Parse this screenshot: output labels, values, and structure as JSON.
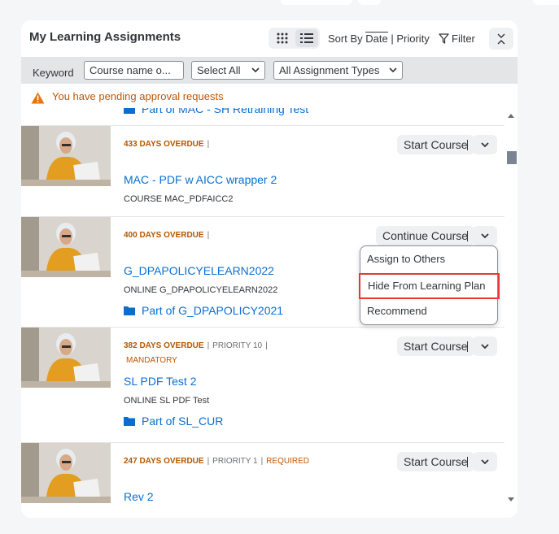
{
  "header": {
    "title": "My Learning Assignments",
    "sort_by_label": "Sort By",
    "sort_date": "Date",
    "sort_separator": "|",
    "sort_priority": "Priority",
    "filter_label": "Filter"
  },
  "filterbar": {
    "keyword_label": "Keyword",
    "keyword_placeholder": "Course name o...",
    "select_all": "Select All",
    "assignment_types": "All Assignment Types"
  },
  "warning": {
    "text": "You have pending approval requests"
  },
  "partial_row": {
    "partof": "Part of MAC - SH Retraining Test"
  },
  "rows": [
    {
      "status": "433 DAYS OVERDUE",
      "sep": "|",
      "title": "MAC - PDF w AICC wrapper 2",
      "code": "COURSE MAC_PDFAICC2",
      "action": "Start Course"
    },
    {
      "status": "400 DAYS OVERDUE",
      "sep": "|",
      "title": "G_DPAPOLICYELEARN2022",
      "code": "ONLINE G_DPAPOLICYELEARN2022",
      "partof": "Part of G_DPAPOLICY2021",
      "action": "Continue Course"
    },
    {
      "status": "382 DAYS OVERDUE",
      "sep": "|",
      "priority": "PRIORITY 10",
      "sep2": "|",
      "mandatory": "MANDATORY",
      "title": "SL PDF Test 2",
      "code": "ONLINE SL PDF Test",
      "partof": "Part of SL_CUR",
      "action": "Start Course"
    },
    {
      "status": "247 DAYS OVERDUE",
      "sep": "|",
      "priority": "PRIORITY 1",
      "sep2": "|",
      "required": "REQUIRED",
      "title": "Rev 2",
      "action": "Start Course"
    }
  ],
  "menu": {
    "items": [
      "Assign to Others",
      "Hide From Learning Plan",
      "Recommend"
    ]
  },
  "colors": {
    "accent": "#0a6ed1",
    "overdue": "#b35600",
    "warning": "#e9730c",
    "highlight_box": "#e53935"
  }
}
